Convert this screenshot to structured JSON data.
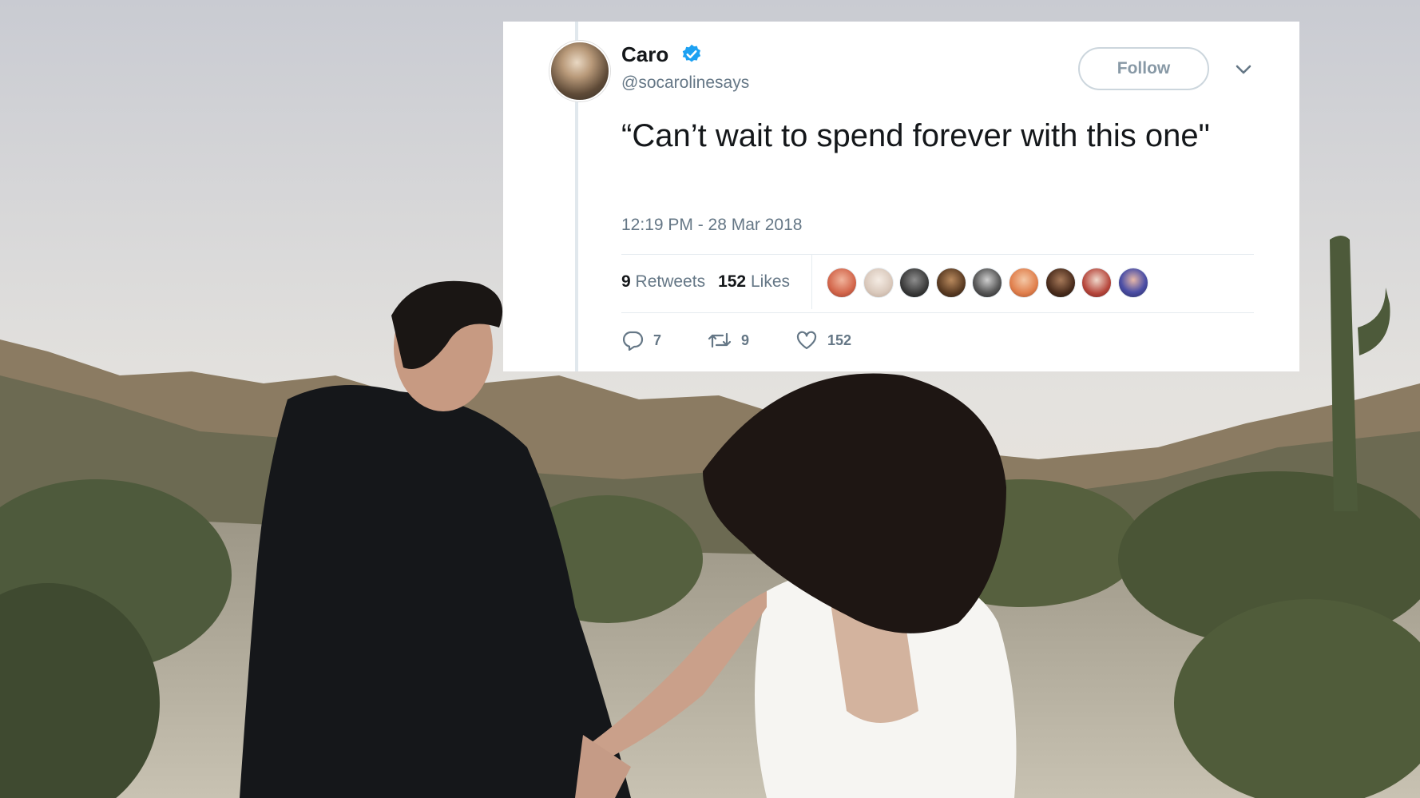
{
  "tweet": {
    "name": "Caro",
    "handle": "@socarolinesays",
    "follow_label": "Follow",
    "text": "“Can’t wait to spend forever with this one\"",
    "timestamp": "12:19 PM - 28 Mar 2018",
    "retweets_count": "9",
    "retweets_label": "Retweets",
    "likes_count": "152",
    "likes_label": "Likes",
    "actions": {
      "replies": "7",
      "retweets": "9",
      "likes": "152"
    },
    "icons": [
      "verified-badge-icon",
      "chevron-down-icon",
      "reply-icon",
      "retweet-icon",
      "heart-icon"
    ]
  },
  "colors": {
    "verified": "#1da1f2",
    "text": "#14171a",
    "secondary": "#657786"
  }
}
